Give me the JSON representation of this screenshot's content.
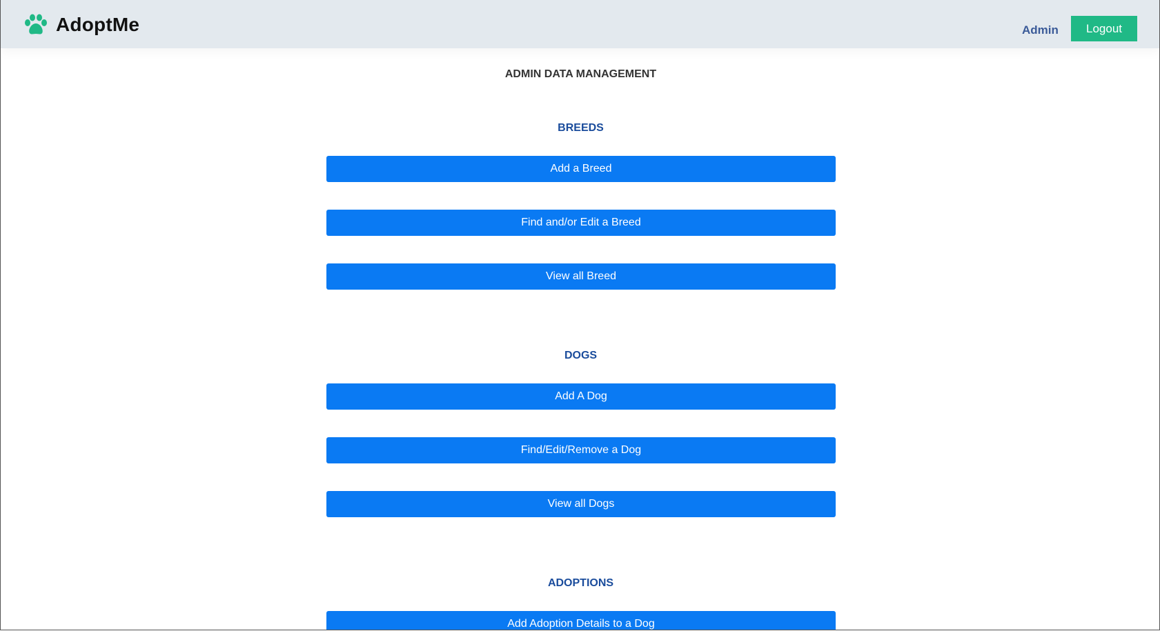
{
  "brand": {
    "name": "AdoptMe",
    "icon": "paw-icon",
    "icon_color": "#20b986"
  },
  "nav": {
    "admin_label": "Admin",
    "logout_label": "Logout"
  },
  "page_title": "ADMIN DATA MANAGEMENT",
  "sections": [
    {
      "heading": "BREEDS",
      "buttons": [
        "Add a Breed",
        "Find and/or Edit a Breed",
        "View all Breed"
      ]
    },
    {
      "heading": "DOGS",
      "buttons": [
        "Add A Dog",
        "Find/Edit/Remove a Dog",
        "View all Dogs"
      ]
    },
    {
      "heading": "ADOPTIONS",
      "buttons": [
        "Add Adoption Details to a Dog"
      ]
    }
  ],
  "colors": {
    "navbar_bg": "#e3e9ee",
    "primary_button": "#0a7af3",
    "logout_button": "#20b986",
    "section_heading": "#1a4c9c"
  }
}
